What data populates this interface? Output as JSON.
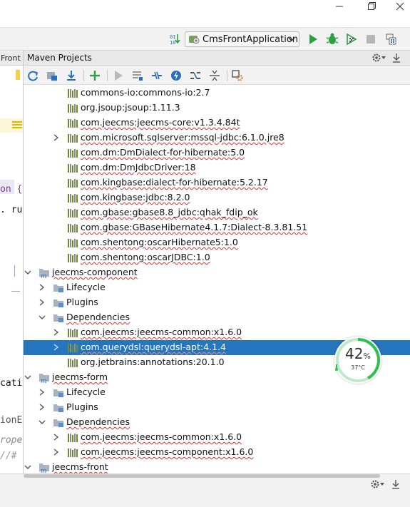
{
  "window": {
    "minimize_icon": "minimize-icon",
    "restore_icon": "restore-icon",
    "close_icon": "close-icon"
  },
  "toolbar": {
    "run_config": "CmsFrontApplication",
    "icons": [
      "binary-data-icon",
      "run-icon",
      "debug-icon",
      "coverage-icon",
      "stop-icon",
      "project-structure-icon"
    ]
  },
  "editor": {
    "tab_label": "Front",
    "snippets": [
      "on {",
      ". ru",
      "cati",
      "ionE",
      "rope",
      "//# "
    ]
  },
  "panel": {
    "title": "Maven Projects",
    "header_icons": [
      "gear-icon",
      "hide-icon"
    ],
    "tool_icons": [
      "reimport-icon",
      "generate-sources-icon",
      "download-icon",
      "add-icon",
      "run-icon",
      "execute-goal-icon",
      "toggle-offline-icon",
      "skip-tests-icon",
      "show-dependencies-icon",
      "collapse-all-icon",
      "settings-icon"
    ],
    "tree": [
      {
        "label": "commons-io:commons-io:2.7",
        "level": 3,
        "arrow": "",
        "icon": "library",
        "error": false
      },
      {
        "label": "org.jsoup:jsoup:1.11.3",
        "level": 3,
        "arrow": "",
        "icon": "library",
        "error": false
      },
      {
        "label": "com.jeecms:jeecms-core:v1.3.4.84t",
        "level": 3,
        "arrow": "",
        "icon": "library",
        "error": true
      },
      {
        "label": "com.microsoft.sqlserver:mssql-jdbc:6.1.0.jre8",
        "level": 3,
        "arrow": "collapsed",
        "icon": "library",
        "error": true
      },
      {
        "label": "com.dm:DmDialect-for-hibernate:5.0",
        "level": 3,
        "arrow": "",
        "icon": "library",
        "error": true
      },
      {
        "label": "com.dm:DmJdbcDriver:18",
        "level": 3,
        "arrow": "",
        "icon": "library",
        "error": true
      },
      {
        "label": "com.kingbase:dialect-for-hibernate:5.2.17",
        "level": 3,
        "arrow": "",
        "icon": "library",
        "error": true
      },
      {
        "label": "com.kingbase:jdbc:8.2.0",
        "level": 3,
        "arrow": "",
        "icon": "library",
        "error": true
      },
      {
        "label": "com.gbase:gbase8.8_jdbc:qhak_fdip_ok",
        "level": 3,
        "arrow": "",
        "icon": "library",
        "error": true
      },
      {
        "label": "com.gbase:GBaseHibernate4.1.7:Dialect-8.3.81.51",
        "level": 3,
        "arrow": "",
        "icon": "library",
        "error": true
      },
      {
        "label": "com.shentong:oscarHibernate5:1.0",
        "level": 3,
        "arrow": "",
        "icon": "library",
        "error": true
      },
      {
        "label": "com.shentong:oscarJDBC:1.0",
        "level": 3,
        "arrow": "",
        "icon": "library",
        "error": true
      },
      {
        "label": "jeecms-component",
        "level": 1,
        "arrow": "expanded",
        "icon": "module",
        "error": true
      },
      {
        "label": "Lifecycle",
        "level": 2,
        "arrow": "collapsed",
        "icon": "folder",
        "error": false
      },
      {
        "label": "Plugins",
        "level": 2,
        "arrow": "collapsed",
        "icon": "folder",
        "error": false
      },
      {
        "label": "Dependencies",
        "level": 2,
        "arrow": "expanded",
        "icon": "folder",
        "error": true
      },
      {
        "label": "com.jeecms:jeecms-common:x1.6.0",
        "level": 3,
        "arrow": "collapsed",
        "icon": "library",
        "error": true
      },
      {
        "label": "com.querydsl:querydsl-apt:4.1.4",
        "level": 3,
        "arrow": "collapsed",
        "icon": "library",
        "error": true,
        "selected": true
      },
      {
        "label": "org.jetbrains:annotations:20.1.0",
        "level": 3,
        "arrow": "",
        "icon": "library",
        "error": false
      },
      {
        "label": "jeecms-form",
        "level": 1,
        "arrow": "expanded",
        "icon": "module",
        "error": true
      },
      {
        "label": "Lifecycle",
        "level": 2,
        "arrow": "collapsed",
        "icon": "folder",
        "error": false
      },
      {
        "label": "Plugins",
        "level": 2,
        "arrow": "collapsed",
        "icon": "folder",
        "error": false
      },
      {
        "label": "Dependencies",
        "level": 2,
        "arrow": "expanded",
        "icon": "folder",
        "error": true
      },
      {
        "label": "com.jeecms:jeecms-common:x1.6.0",
        "level": 3,
        "arrow": "collapsed",
        "icon": "library",
        "error": true
      },
      {
        "label": "com.jeecms:jeecms-component:x1.6.0",
        "level": 3,
        "arrow": "collapsed",
        "icon": "library",
        "error": true
      },
      {
        "label": "jeecms-front",
        "level": 1,
        "arrow": "expanded",
        "icon": "module",
        "error": true
      }
    ]
  },
  "bottom_icons": [
    "gear-icon",
    "hide-icon"
  ],
  "widget": {
    "cpu_percent": "42",
    "percent_sign": "%",
    "temperature": "37°C",
    "cpu_fraction": 0.42,
    "ring_color": "#2fbf4f"
  },
  "colors": {
    "selection": "#2675bf",
    "error_underline": "#d52f2f",
    "run_green": "#2ea043"
  }
}
